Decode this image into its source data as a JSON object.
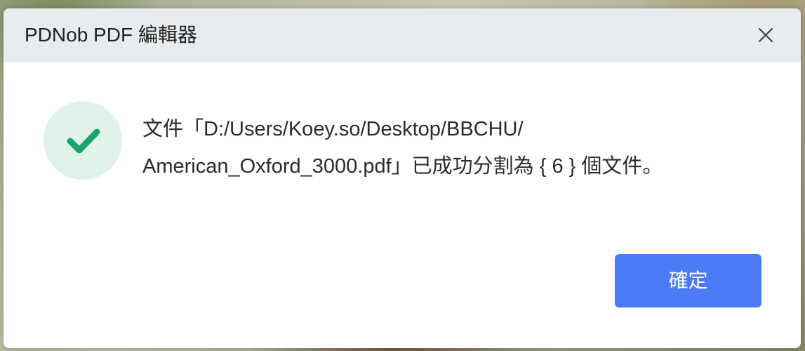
{
  "window": {
    "title": "PDNob PDF 編輯器",
    "close_icon": "close-icon"
  },
  "status": {
    "icon": "check-icon",
    "icon_color": "#1aa36a",
    "badge_color": "#e0f3ea"
  },
  "message": {
    "line1": "文件「D:/Users/Koey.so/Desktop/BBCHU/",
    "line2": "American_Oxford_3000.pdf」已成功分割為 { 6 } 個文件。"
  },
  "actions": {
    "confirm_label": "確定",
    "confirm_color": "#4d7bf7"
  }
}
